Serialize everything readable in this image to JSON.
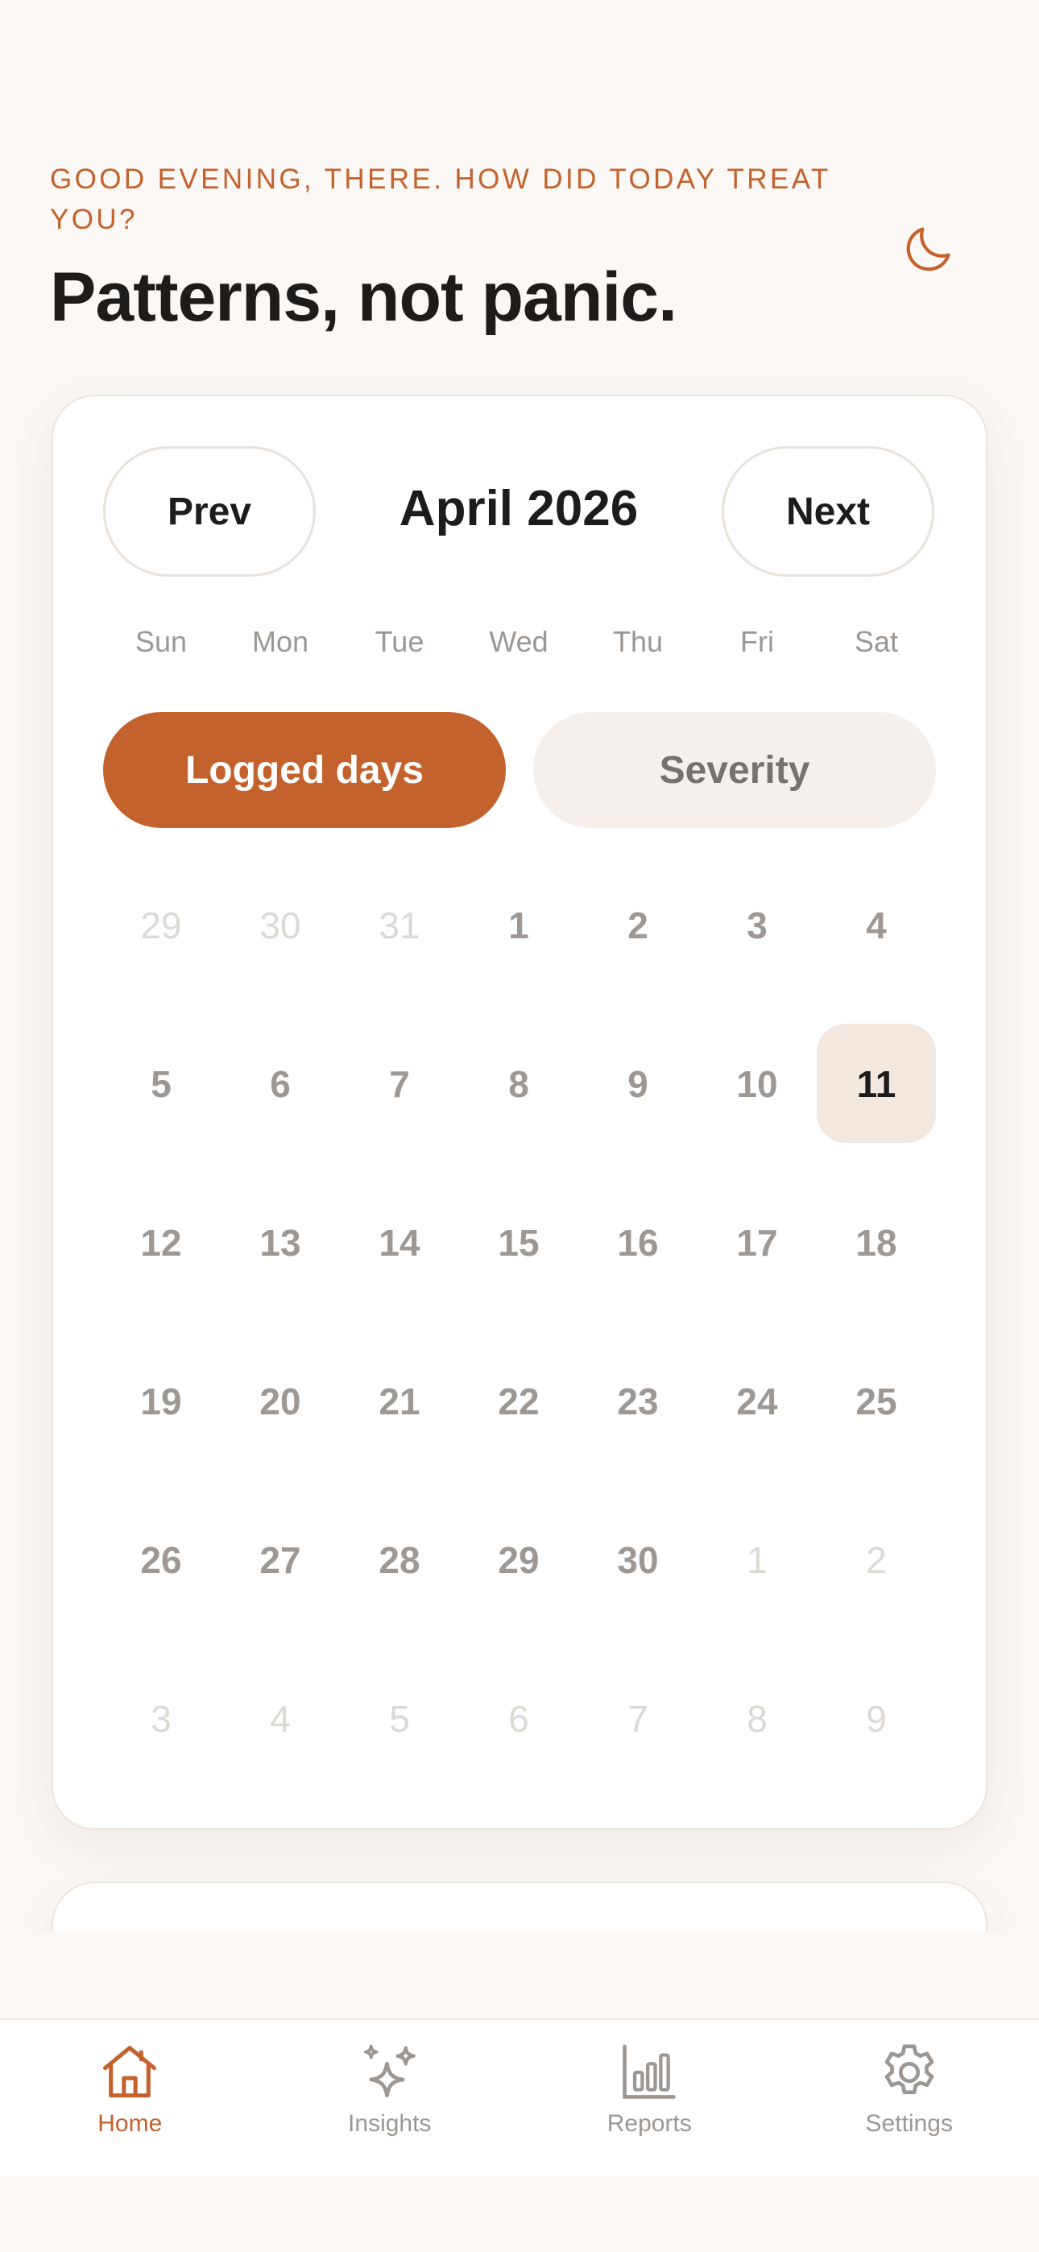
{
  "header": {
    "greeting": "GOOD EVENING, THERE. HOW DID TODAY TREAT YOU?",
    "headline": "Patterns, not panic."
  },
  "calendar": {
    "prev_label": "Prev",
    "next_label": "Next",
    "month_title": "April 2026",
    "weekdays": [
      "Sun",
      "Mon",
      "Tue",
      "Wed",
      "Thu",
      "Fri",
      "Sat"
    ],
    "modes": {
      "active": "Logged days",
      "inactive": "Severity"
    },
    "days": [
      {
        "label": "29",
        "state": "other"
      },
      {
        "label": "30",
        "state": "other"
      },
      {
        "label": "31",
        "state": "other"
      },
      {
        "label": "1",
        "state": "current"
      },
      {
        "label": "2",
        "state": "current"
      },
      {
        "label": "3",
        "state": "current"
      },
      {
        "label": "4",
        "state": "current"
      },
      {
        "label": "5",
        "state": "current"
      },
      {
        "label": "6",
        "state": "current"
      },
      {
        "label": "7",
        "state": "current"
      },
      {
        "label": "8",
        "state": "current"
      },
      {
        "label": "9",
        "state": "current"
      },
      {
        "label": "10",
        "state": "current"
      },
      {
        "label": "11",
        "state": "today"
      },
      {
        "label": "12",
        "state": "current"
      },
      {
        "label": "13",
        "state": "current"
      },
      {
        "label": "14",
        "state": "current"
      },
      {
        "label": "15",
        "state": "current"
      },
      {
        "label": "16",
        "state": "current"
      },
      {
        "label": "17",
        "state": "current"
      },
      {
        "label": "18",
        "state": "current"
      },
      {
        "label": "19",
        "state": "current"
      },
      {
        "label": "20",
        "state": "current"
      },
      {
        "label": "21",
        "state": "current"
      },
      {
        "label": "22",
        "state": "current"
      },
      {
        "label": "23",
        "state": "current"
      },
      {
        "label": "24",
        "state": "current"
      },
      {
        "label": "25",
        "state": "current"
      },
      {
        "label": "26",
        "state": "current"
      },
      {
        "label": "27",
        "state": "current"
      },
      {
        "label": "28",
        "state": "current"
      },
      {
        "label": "29",
        "state": "current"
      },
      {
        "label": "30",
        "state": "current"
      },
      {
        "label": "1",
        "state": "other"
      },
      {
        "label": "2",
        "state": "other"
      },
      {
        "label": "3",
        "state": "other"
      },
      {
        "label": "4",
        "state": "other"
      },
      {
        "label": "5",
        "state": "other"
      },
      {
        "label": "6",
        "state": "other"
      },
      {
        "label": "7",
        "state": "other"
      },
      {
        "label": "8",
        "state": "other"
      },
      {
        "label": "9",
        "state": "other"
      }
    ]
  },
  "tabbar": {
    "items": [
      {
        "label": "Home",
        "icon": "home-icon",
        "active": true
      },
      {
        "label": "Insights",
        "icon": "sparkles-icon",
        "active": false
      },
      {
        "label": "Reports",
        "icon": "bar-chart-icon",
        "active": false
      },
      {
        "label": "Settings",
        "icon": "gear-icon",
        "active": false
      }
    ]
  },
  "colors": {
    "accent": "#C4622D",
    "background": "#FBF8F6",
    "today_highlight": "#F3E8DF",
    "muted_text": "#9C9793"
  }
}
